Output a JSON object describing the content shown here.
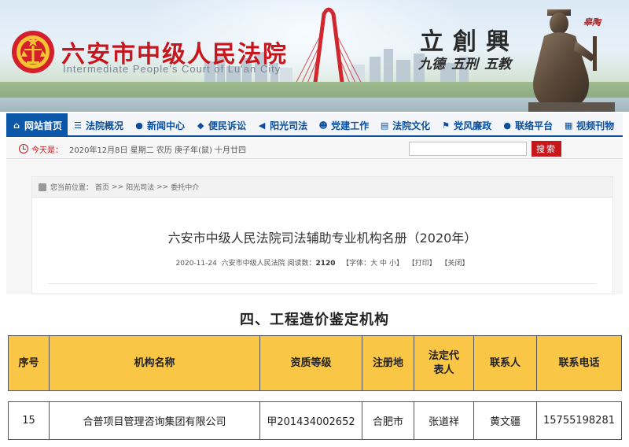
{
  "header": {
    "court_name": "六安市中级人民法院",
    "court_name_en": "Intermediate People's Court of Lu'an City",
    "motto": [
      {
        "main": "立",
        "sub": "九德"
      },
      {
        "main": "創",
        "sub": "五刑"
      },
      {
        "main": "興",
        "sub": "五教"
      }
    ],
    "statue_signature": "皋陶"
  },
  "nav": {
    "items": [
      {
        "label": "网站首页",
        "icon": "home-icon",
        "active": true
      },
      {
        "label": "法院概况",
        "icon": "list-icon"
      },
      {
        "label": "新闻中心",
        "icon": "globe-icon"
      },
      {
        "label": "便民诉讼",
        "icon": "gavel-icon"
      },
      {
        "label": "阳光司法",
        "icon": "megaphone-icon"
      },
      {
        "label": "党建工作",
        "icon": "people-icon"
      },
      {
        "label": "法院文化",
        "icon": "book-icon"
      },
      {
        "label": "党风廉政",
        "icon": "flag-icon"
      },
      {
        "label": "联络平台",
        "icon": "link-icon"
      },
      {
        "label": "视频刊物",
        "icon": "video-icon"
      }
    ]
  },
  "datebar": {
    "today_label": "今天是：",
    "today_value": "2020年12月8日 星期二 农历 庚子年(鼠) 十月廿四",
    "search_placeholder": "",
    "search_button": "搜索"
  },
  "breadcrumb": {
    "prefix": "您当前位置：",
    "items": [
      "首页",
      "阳光司法",
      "委托中介"
    ],
    "separator": ">>"
  },
  "article": {
    "title": "六安市中级人民法院司法辅助专业机构名册（2020年）",
    "date": "2020-11-24",
    "source": "六安市中级人民法院",
    "reads_label": "阅读数：",
    "reads": "2120",
    "font_label": "【字体：",
    "font_large": "大",
    "font_medium": "中",
    "font_small": "小",
    "font_close": "】",
    "print": "【打印】",
    "close": "【关闭】"
  },
  "section": {
    "title": "四、工程造价鉴定机构"
  },
  "table": {
    "headers": [
      "序号",
      "机构名称",
      "资质等级",
      "注册地",
      "法定代表人",
      "联系人",
      "联系电话"
    ],
    "rows": [
      [
        "15",
        "合普项目管理咨询集团有限公司",
        "甲201434002652",
        "合肥市",
        "张道祥",
        "黄文疆",
        "15755198281"
      ]
    ]
  },
  "colors": {
    "brand_red": "#c8161d",
    "nav_blue": "#0b4f9c",
    "table_header": "#f9c646"
  }
}
